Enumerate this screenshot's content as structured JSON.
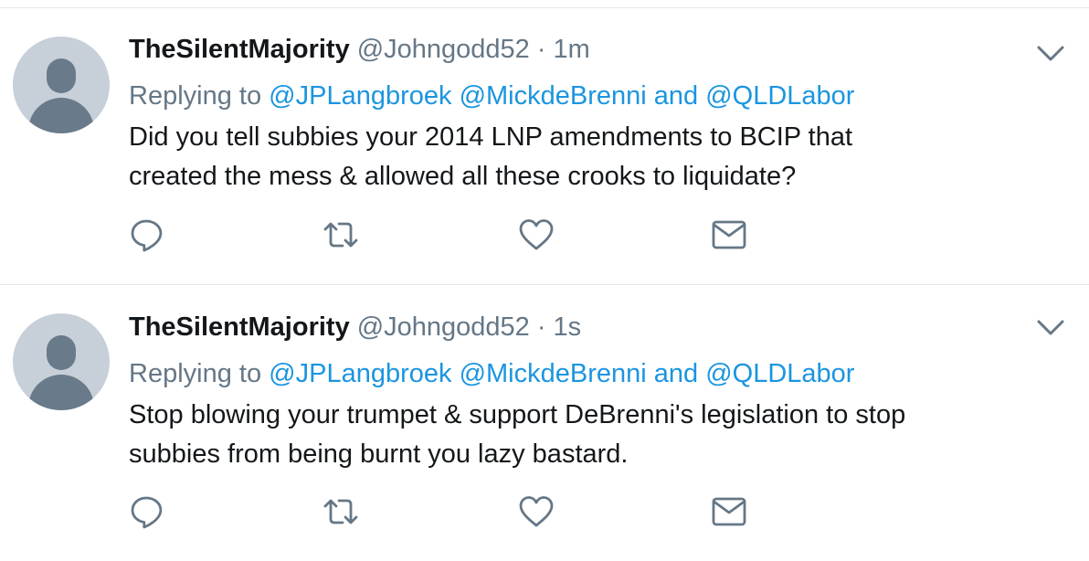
{
  "tweets": [
    {
      "display_name": "TheSilentMajority",
      "handle": "@Johngodd52",
      "separator": "·",
      "time": "1m",
      "replying_prefix": "Replying to",
      "mention_1": "@JPLangbroek",
      "mention_2": "@MickdeBrenni",
      "replying_and": "and",
      "mention_3": "@QLDLabor",
      "text_line_1": "Did you tell subbies your 2014 LNP amendments to BCIP that",
      "text_line_2": "created the mess & allowed all these crooks to liquidate?"
    },
    {
      "display_name": "TheSilentMajority",
      "handle": "@Johngodd52",
      "separator": "·",
      "time": "1s",
      "replying_prefix": "Replying to",
      "mention_1": "@JPLangbroek",
      "mention_2": "@MickdeBrenni",
      "replying_and": "and",
      "mention_3": "@QLDLabor",
      "text_line_1": "Stop blowing your trumpet & support DeBrenni's legislation to stop",
      "text_line_2": "subbies from being burnt you lazy bastard."
    }
  ],
  "icons": {
    "reply": "reply-icon",
    "retweet": "retweet-icon",
    "like": "heart-icon",
    "dm": "envelope-icon",
    "caret": "chevron-down-icon"
  },
  "colors": {
    "link": "#1b95e0",
    "secondary_text": "#657786",
    "primary_text": "#14171a",
    "divider": "#e1e8ed",
    "avatar_bg": "#c7d0d8",
    "avatar_fg": "#697a8b"
  }
}
